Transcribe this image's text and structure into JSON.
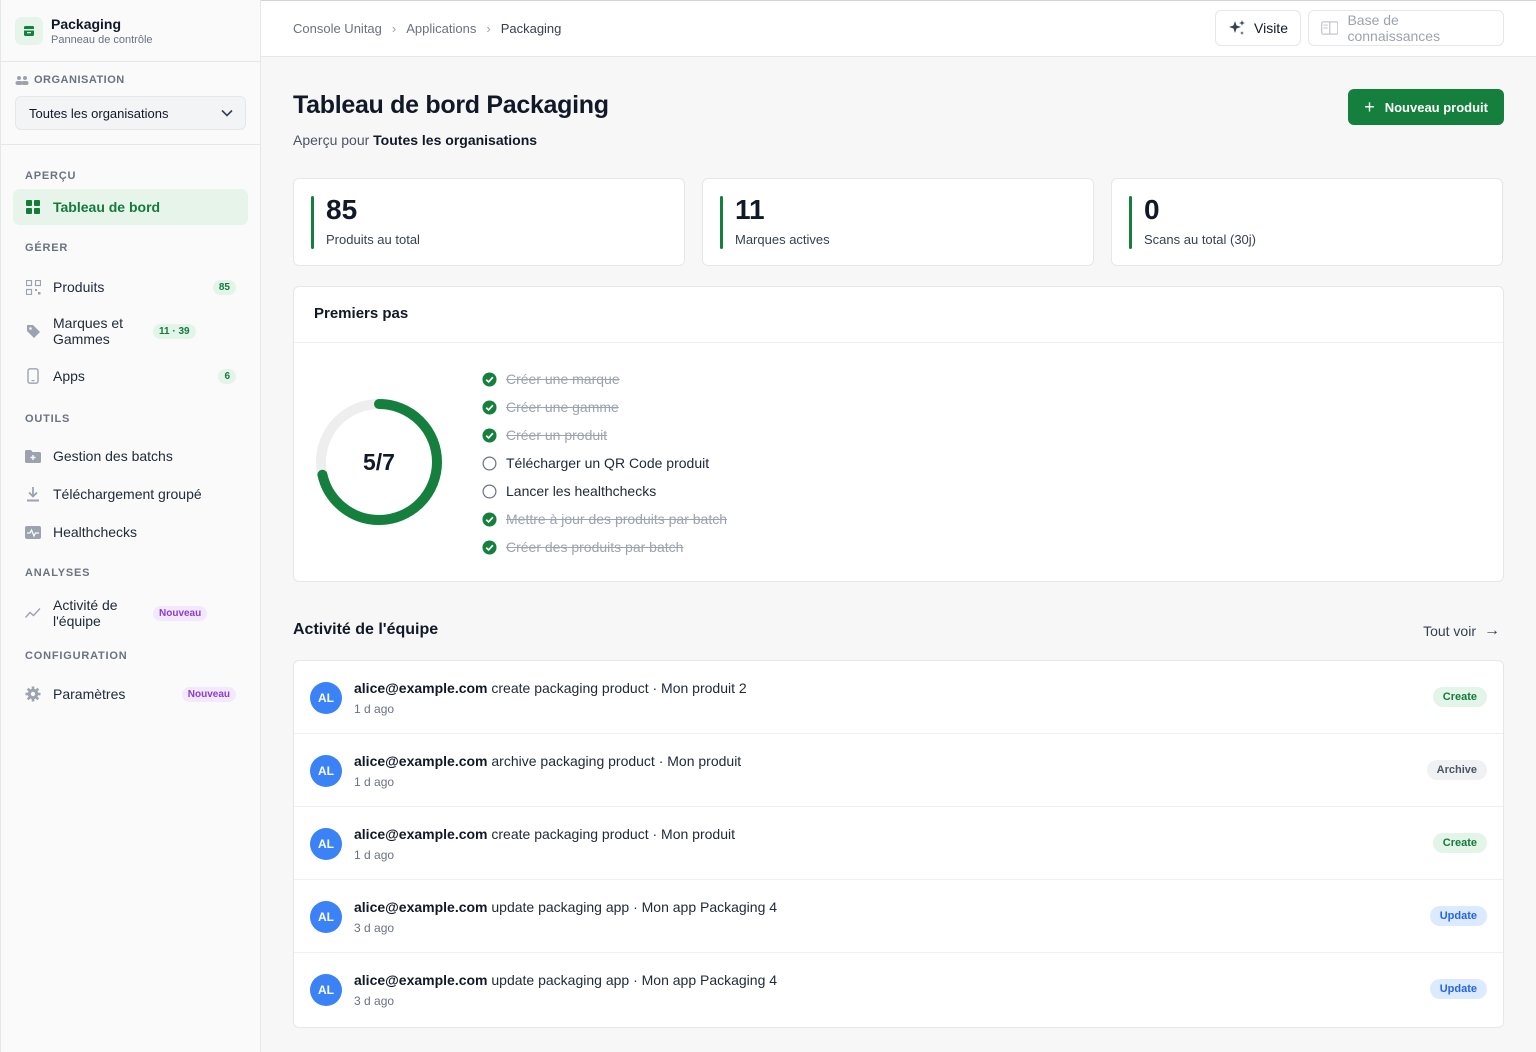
{
  "brand": {
    "title": "Packaging",
    "subtitle": "Panneau de contrôle"
  },
  "organisation": {
    "label": "ORGANISATION",
    "selected": "Toutes les organisations"
  },
  "nav": {
    "apercu_label": "APERÇU",
    "dashboard": "Tableau de bord",
    "gerer_label": "GÉRER",
    "produits": {
      "label": "Produits",
      "badge": "85"
    },
    "marques": {
      "label": "Marques et Gammes",
      "badge": "11 · 39"
    },
    "apps": {
      "label": "Apps",
      "badge": "6"
    },
    "outils_label": "OUTILS",
    "batchs": "Gestion des batchs",
    "telechargement": "Téléchargement groupé",
    "healthchecks": "Healthchecks",
    "analyses_label": "ANALYSES",
    "activite": {
      "label": "Activité de l'équipe",
      "badge": "Nouveau"
    },
    "config_label": "CONFIGURATION",
    "parametres": {
      "label": "Paramètres",
      "badge": "Nouveau"
    }
  },
  "breadcrumb": [
    "Console Unitag",
    "Applications",
    "Packaging"
  ],
  "topbar": {
    "visite": "Visite",
    "kb": "Base de connaissances"
  },
  "header": {
    "title": "Tableau de bord Packaging",
    "subtitle_prefix": "Aperçu pour",
    "subtitle_org": "Toutes les organisations",
    "new_button": "Nouveau produit"
  },
  "stats": [
    {
      "value": "85",
      "label": "Produits au total"
    },
    {
      "value": "11",
      "label": "Marques actives"
    },
    {
      "value": "0",
      "label": "Scans au total (30j)"
    }
  ],
  "onboarding": {
    "title": "Premiers pas",
    "progress_text": "5/7",
    "progress_fraction": 0.714,
    "steps": [
      {
        "label": "Créer une marque",
        "done": true
      },
      {
        "label": "Créer une gamme",
        "done": true
      },
      {
        "label": "Créer un produit",
        "done": true
      },
      {
        "label": "Télécharger un QR Code produit",
        "done": false
      },
      {
        "label": "Lancer les healthchecks",
        "done": false
      },
      {
        "label": "Mettre à jour des produits par batch",
        "done": true
      },
      {
        "label": "Créer des produits par batch",
        "done": true
      }
    ]
  },
  "activity": {
    "title": "Activité de l'équipe",
    "see_all": "Tout voir",
    "rows": [
      {
        "initials": "AL",
        "user": "alice@example.com",
        "action": "create packaging product · Mon produit 2",
        "time": "1 d ago",
        "tag": "Create",
        "kind": "create"
      },
      {
        "initials": "AL",
        "user": "alice@example.com",
        "action": "archive packaging product · Mon produit",
        "time": "1 d ago",
        "tag": "Archive",
        "kind": "archive"
      },
      {
        "initials": "AL",
        "user": "alice@example.com",
        "action": "create packaging product · Mon produit",
        "time": "1 d ago",
        "tag": "Create",
        "kind": "create"
      },
      {
        "initials": "AL",
        "user": "alice@example.com",
        "action": "update packaging app · Mon app Packaging 4",
        "time": "3 d ago",
        "tag": "Update",
        "kind": "update"
      },
      {
        "initials": "AL",
        "user": "alice@example.com",
        "action": "update packaging app · Mon app Packaging 4",
        "time": "3 d ago",
        "tag": "Update",
        "kind": "update"
      }
    ]
  },
  "colors": {
    "accent": "#15803d",
    "accent_bg": "#e6f4ea",
    "avatar": "#3b82f6",
    "ring_track": "#eeeeee"
  }
}
